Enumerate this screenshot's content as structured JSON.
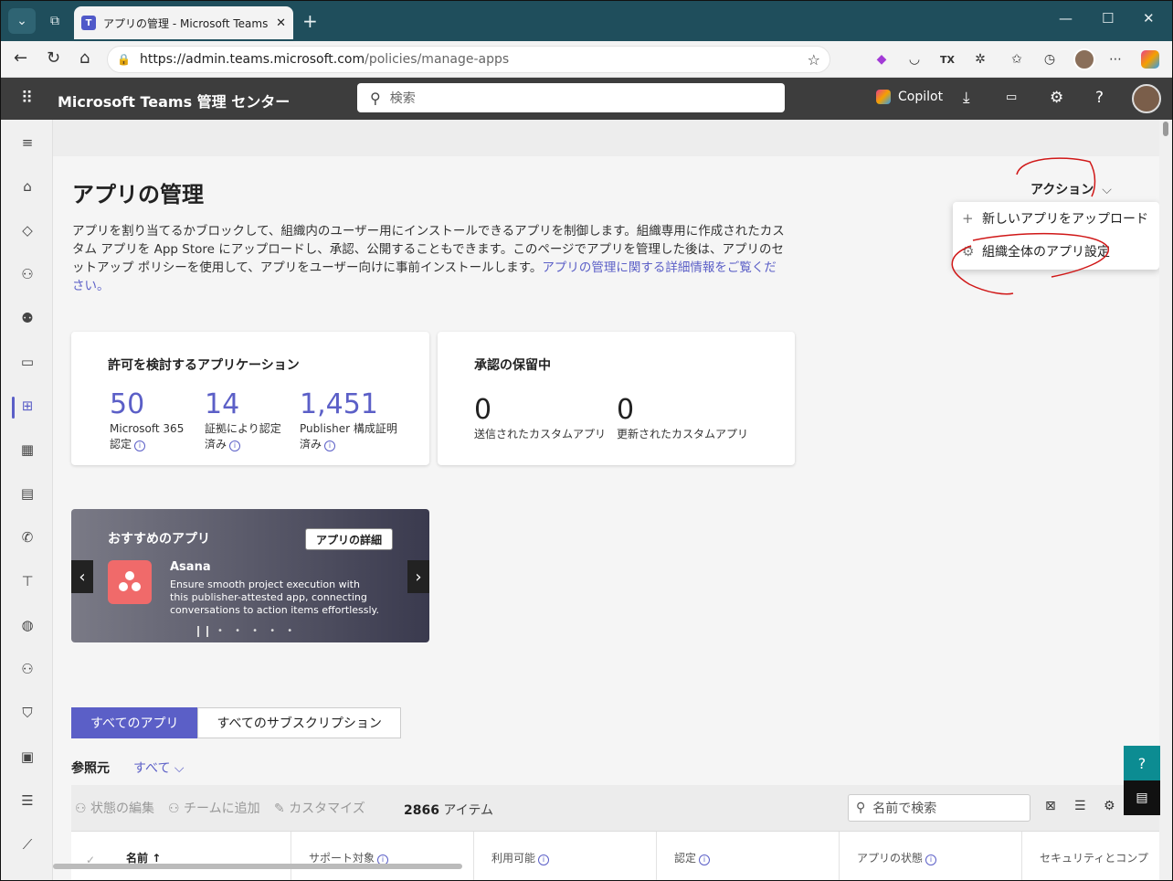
{
  "browser": {
    "tab_title": "アプリの管理 - Microsoft Teams 管理",
    "tab_icon": "T",
    "url_host": "https://admin.teams.microsoft.com",
    "url_path": "/policies/manage-apps"
  },
  "header": {
    "app_name": "Microsoft Teams 管理 センター",
    "search_placeholder": "検索",
    "copilot_label": "Copilot"
  },
  "page": {
    "title": "アプリの管理",
    "description": "アプリを割り当てるかブロックして、組織内のユーザー用にインストールできるアプリを制御します。組織専用に作成されたカスタム アプリを App Store にアップロードし、承認、公開することもできます。このページでアプリを管理した後は、アプリのセットアップ ポリシーを使用して、アプリをユーザー向けに事前インストールします。",
    "description_link": "アプリの管理に関する詳細情報をご覧ください。",
    "actions_label": "アクション",
    "actions_menu": [
      {
        "icon": "plus-icon",
        "label": "新しいアプリをアップロード"
      },
      {
        "icon": "gear-icon",
        "label": "組織全体のアプリ設定"
      }
    ]
  },
  "review_card": {
    "title": "許可を検討するアプリケーション",
    "stats": [
      {
        "value": "50",
        "label": "Microsoft 365 認定"
      },
      {
        "value": "14",
        "label": "証拠により認定済み"
      },
      {
        "value": "1,451",
        "label": "Publisher 構成証明済み"
      }
    ]
  },
  "pending_card": {
    "title": "承認の保留中",
    "stats": [
      {
        "value": "0",
        "label": "送信されたカスタムアプリ"
      },
      {
        "value": "0",
        "label": "更新されたカスタムアプリ"
      }
    ]
  },
  "featured": {
    "title": "おすすめのアプリ",
    "details_button": "アプリの詳細",
    "app_name": "Asana",
    "app_description": "Ensure smooth project execution with this publisher-attested app, connecting conversations to action items effortlessly.",
    "page_dots": "• • • • •"
  },
  "tabs": [
    "すべてのアプリ",
    "すべてのサブスクリプション"
  ],
  "filter": {
    "label": "参照元",
    "value": "すべて"
  },
  "toolbar": {
    "edit_status": "状態の編集",
    "add_to_team": "チームに追加",
    "customize": "カスタマイズ",
    "count_value": "2866",
    "count_unit": "アイテム",
    "search_placeholder": "名前で検索"
  },
  "table": {
    "columns": [
      "名前",
      "サポート対象",
      "利用可能",
      "認定",
      "アプリの状態",
      "セキュリティとコンプ"
    ]
  },
  "colors": {
    "accent": "#5b5fc7",
    "header": "#3d3d3d",
    "tabbar": "#1f4e5c"
  }
}
